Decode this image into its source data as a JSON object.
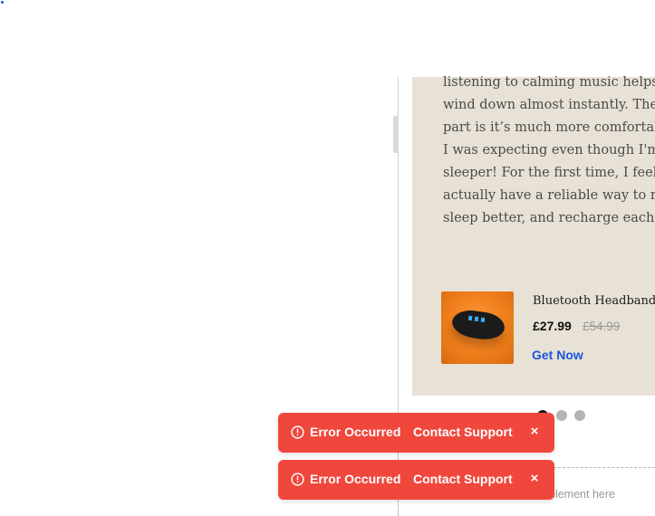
{
  "review": {
    "lines": [
      "listening to calming music helps me",
      "wind down almost instantly. The best",
      "part is it’s much more comfortable than",
      "I was expecting even though I'm a side",
      "sleeper! For the first time, I feel like I",
      "actually have a reliable way to relax,",
      "sleep better, and recharge each night."
    ]
  },
  "product": {
    "title": "Bluetooth Headband",
    "price": "£27.99",
    "old_price": "£54.99",
    "cta": "Get Now",
    "image_icon": "headband-product-image"
  },
  "carousel": {
    "dot_count": 3,
    "active_index": 0
  },
  "drop_zone": {
    "label": "element here"
  },
  "toasts": [
    {
      "title": "Error Occurred",
      "action": "Contact Support",
      "close": "×",
      "icon": "alert-circle-icon"
    },
    {
      "title": "Error Occurred",
      "action": "Contact Support",
      "close": "×",
      "icon": "alert-circle-icon"
    }
  ],
  "colors": {
    "toast_bg": "#f0473c",
    "card_bg": "#e8e1d6",
    "link": "#1a56db"
  }
}
